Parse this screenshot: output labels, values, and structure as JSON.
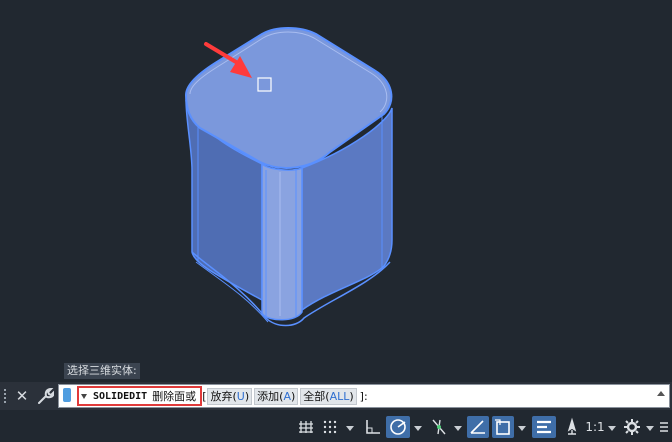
{
  "prompt_history": "选择三维实体:",
  "command_line": {
    "command_name": "SOLIDEDIT",
    "command_prompt": "删除面或",
    "bracket_open": "[",
    "options": [
      {
        "label": "放弃(",
        "key": "U",
        "close": ")"
      },
      {
        "label": "添加(",
        "key": "A",
        "close": ")"
      },
      {
        "label": "全部(",
        "key": "ALL",
        "close": ")"
      }
    ],
    "bracket_close": "]:"
  },
  "status_bar": {
    "scale_label": "1:1"
  },
  "colors": {
    "viewport_bg": "#212830",
    "solid_face": "#7b98dc",
    "solid_side_dark": "#4f6db3",
    "solid_side_mid": "#6b88d0",
    "selection_outline": "#4f8cff",
    "callout_arrow": "#ff3b3b",
    "highlight_box": "#e03a3a",
    "active_toggle": "#3f6ea8"
  },
  "icons": [
    "close-icon",
    "wrench-icon",
    "grid-icon",
    "snap-grid-icon",
    "ortho-icon",
    "polar-tracking-icon",
    "object-snap-tracking-icon",
    "dynamic-ucs-icon",
    "isometric-icon",
    "lineweight-icon",
    "annotation-scale-icon",
    "gear-icon",
    "menu-icon"
  ]
}
